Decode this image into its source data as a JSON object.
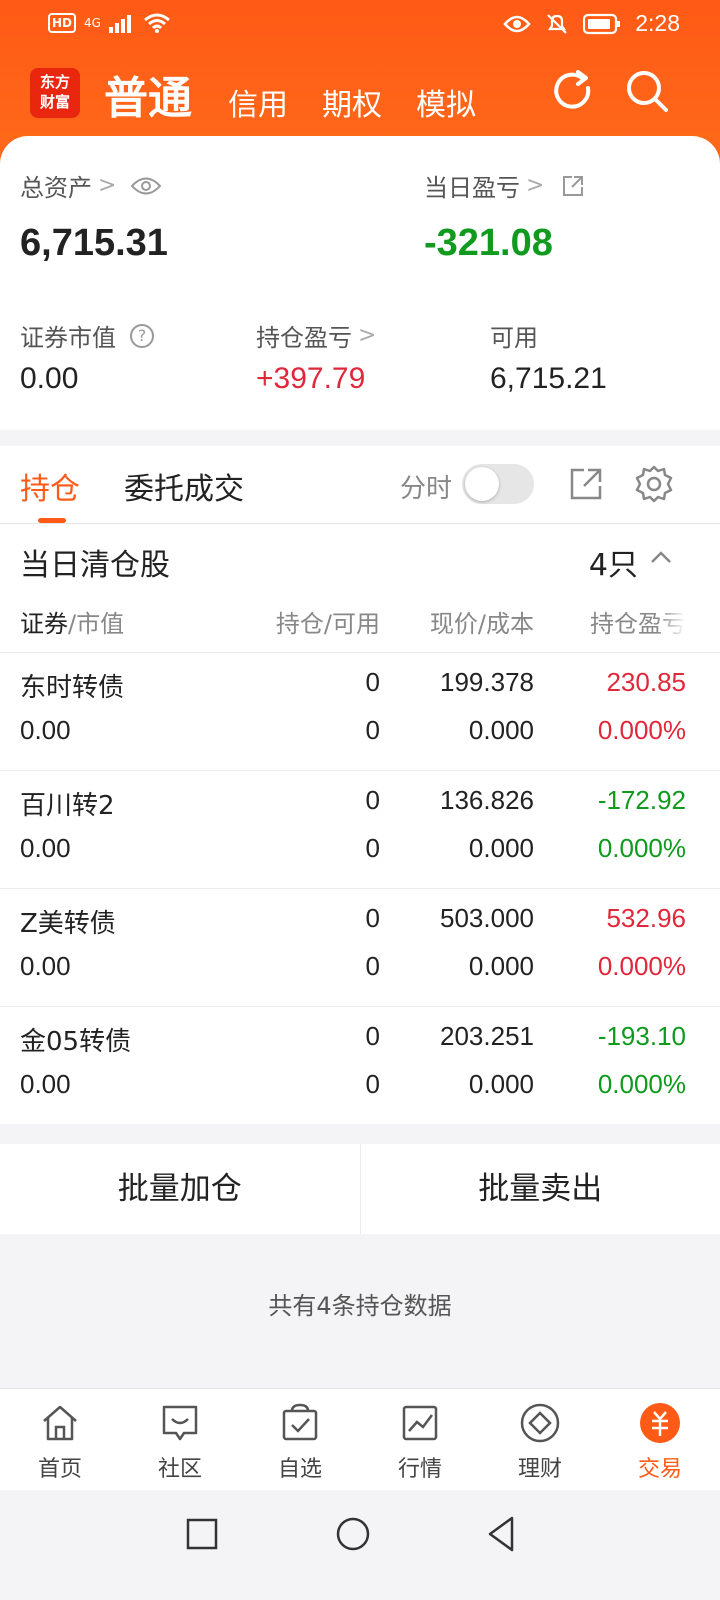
{
  "status_bar": {
    "hd": "HD",
    "network": "4G",
    "time": "2:28"
  },
  "brand": {
    "logo_line1": "东方",
    "logo_line2": "财富"
  },
  "top_tabs": {
    "active": "普通",
    "credit": "信用",
    "options": "期权",
    "simulate": "模拟"
  },
  "summary": {
    "total_assets_label": "总资产",
    "total_assets_value": "6,715.31",
    "daily_pnl_label": "当日盈亏",
    "daily_pnl_value": "-321.08",
    "market_value_label": "证券市值",
    "market_value": "0.00",
    "holding_pnl_label": "持仓盈亏",
    "holding_pnl_value": "+397.79",
    "available_label": "可用",
    "available_value": "6,715.21"
  },
  "tabs": {
    "holdings": "持仓",
    "orders": "委托成交",
    "intraday": "分时"
  },
  "section": {
    "title": "当日清仓股",
    "count": "4只"
  },
  "columns": {
    "security": "证券",
    "market_value": "/市值",
    "position": "持仓/可用",
    "price": "现价/成本",
    "pnl": "持仓盈亏"
  },
  "positions": [
    {
      "name": "东时转债",
      "value": "0.00",
      "qty": "0",
      "avail": "0",
      "price": "199.378",
      "cost": "0.000",
      "pnl": "230.85",
      "pct": "0.000%",
      "color": "#e0283a"
    },
    {
      "name": "百川转2",
      "value": "0.00",
      "qty": "0",
      "avail": "0",
      "price": "136.826",
      "cost": "0.000",
      "pnl": "-172.92",
      "pct": "0.000%",
      "color": "#109a1e"
    },
    {
      "name": "Z美转债",
      "value": "0.00",
      "qty": "0",
      "avail": "0",
      "price": "503.000",
      "cost": "0.000",
      "pnl": "532.96",
      "pct": "0.000%",
      "color": "#e0283a"
    },
    {
      "name": "金05转债",
      "value": "0.00",
      "qty": "0",
      "avail": "0",
      "price": "203.251",
      "cost": "0.000",
      "pnl": "-193.10",
      "pct": "0.000%",
      "color": "#109a1e"
    }
  ],
  "batch": {
    "add": "批量加仓",
    "sell": "批量卖出"
  },
  "footer_note": "共有4条持仓数据",
  "bottom_nav": [
    {
      "label": "首页",
      "icon": "home-icon"
    },
    {
      "label": "社区",
      "icon": "community-icon"
    },
    {
      "label": "自选",
      "icon": "watchlist-icon"
    },
    {
      "label": "行情",
      "icon": "market-icon"
    },
    {
      "label": "理财",
      "icon": "wealth-icon"
    },
    {
      "label": "交易",
      "icon": "trade-icon"
    }
  ],
  "colors": {
    "brand": "#ff5a16",
    "up": "#e0283a",
    "down": "#109a1e"
  }
}
